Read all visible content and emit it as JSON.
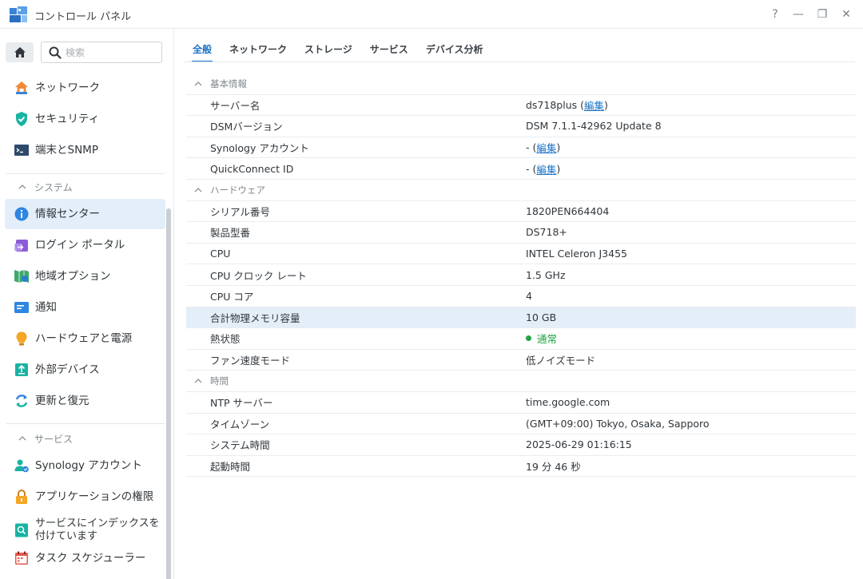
{
  "window": {
    "title": "コントロール パネル",
    "controls": {
      "help": "?",
      "minimize": "—",
      "restore": "❐",
      "close": "✕"
    }
  },
  "sidebar": {
    "search_placeholder": "検索",
    "items_top": [
      {
        "label": "ネットワーク",
        "icon": "network-icon"
      },
      {
        "label": "セキュリティ",
        "icon": "security-shield-icon"
      },
      {
        "label": "端末とSNMP",
        "icon": "terminal-icon"
      }
    ],
    "section_system": "システム",
    "items_system": [
      {
        "label": "情報センター",
        "icon": "info-center-icon",
        "active": true
      },
      {
        "label": "ログイン ポータル",
        "icon": "login-portal-icon"
      },
      {
        "label": "地域オプション",
        "icon": "regional-options-icon"
      },
      {
        "label": "通知",
        "icon": "notification-icon"
      },
      {
        "label": "ハードウェアと電源",
        "icon": "hardware-power-icon"
      },
      {
        "label": "外部デバイス",
        "icon": "external-device-icon"
      },
      {
        "label": "更新と復元",
        "icon": "update-restore-icon"
      }
    ],
    "section_services": "サービス",
    "items_services": [
      {
        "label": "Synology アカウント",
        "icon": "synology-account-icon"
      },
      {
        "label": "アプリケーションの権限",
        "icon": "app-privileges-icon"
      },
      {
        "label_line1": "サービスにインデックスを",
        "label_line2": "付けています",
        "icon": "indexing-service-icon"
      },
      {
        "label": "タスク スケジューラー",
        "icon": "task-scheduler-icon"
      }
    ]
  },
  "tabs": [
    "全般",
    "ネットワーク",
    "ストレージ",
    "サービス",
    "デバイス分析"
  ],
  "active_tab": 0,
  "general": {
    "basic": {
      "title": "基本情報",
      "server_name_label": "サーバー名",
      "server_name_value": "ds718plus (",
      "server_name_suffix": ")",
      "edit": "編集",
      "dsm_label": "DSMバージョン",
      "dsm_value": "DSM 7.1.1-42962 Update 8",
      "account_label": "Synology アカウント",
      "account_value": "- (",
      "account_suffix": ")",
      "quickconnect_label": "QuickConnect ID",
      "quickconnect_value": "- (",
      "quickconnect_suffix": ")"
    },
    "hardware": {
      "title": "ハードウェア",
      "serial_label": "シリアル番号",
      "serial_value": "1820PEN664404",
      "model_label": "製品型番",
      "model_value": "DS718+",
      "cpu_label": "CPU",
      "cpu_value": "INTEL Celeron J3455",
      "clock_label": "CPU クロック レート",
      "clock_value": "1.5 GHz",
      "cores_label": "CPU コア",
      "cores_value": "4",
      "memory_label": "合計物理メモリ容量",
      "memory_value": "10 GB",
      "thermal_label": "熱状態",
      "thermal_value": "通常",
      "fan_label": "ファン速度モード",
      "fan_value": "低ノイズモード"
    },
    "time": {
      "title": "時間",
      "ntp_label": "NTP サーバー",
      "ntp_value": "time.google.com",
      "timezone_label": "タイムゾーン",
      "timezone_value": "(GMT+09:00) Tokyo, Osaka, Sapporo",
      "systime_label": "システム時間",
      "systime_value": "2025-06-29 01:16:15",
      "uptime_label": "起動時間",
      "uptime_value": "19 分 46 秒"
    }
  },
  "colors": {
    "accent": "#1a73c7",
    "status_ok": "#22a443",
    "highlight": "#e4eef9"
  }
}
